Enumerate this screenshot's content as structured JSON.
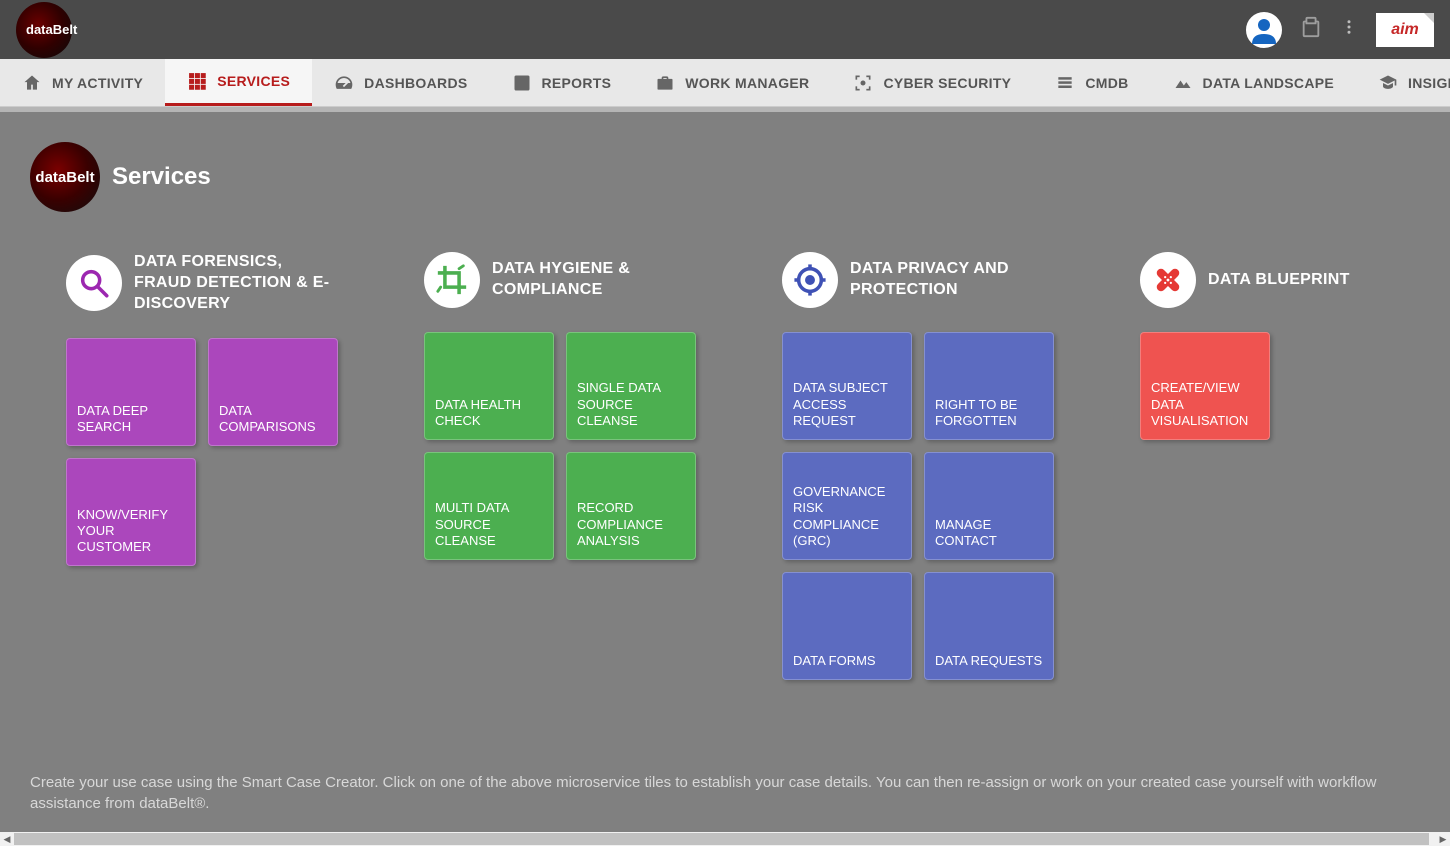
{
  "header": {
    "logo_text": "dataBelt",
    "aim_label": "aim"
  },
  "nav": [
    {
      "label": "MY ACTIVITY",
      "icon": "home"
    },
    {
      "label": "SERVICES",
      "icon": "grid",
      "active": true
    },
    {
      "label": "DASHBOARDS",
      "icon": "speed"
    },
    {
      "label": "REPORTS",
      "icon": "barchart"
    },
    {
      "label": "WORK MANAGER",
      "icon": "briefcase"
    },
    {
      "label": "CYBER SECURITY",
      "icon": "target-square"
    },
    {
      "label": "CMDB",
      "icon": "db"
    },
    {
      "label": "DATA LANDSCAPE",
      "icon": "landscape"
    },
    {
      "label": "INSIGHT SPACE",
      "icon": "grad"
    }
  ],
  "page": {
    "logo_text": "dataBelt",
    "title": "Services"
  },
  "categories": [
    {
      "title": "DATA FORENSICS, FRAUD DETECTION & E-DISCOVERY",
      "icon": "search",
      "icon_color": "#9c27b0",
      "color": "purple",
      "tiles": [
        "DATA DEEP SEARCH",
        "DATA COMPARISONS",
        "KNOW/VERIFY YOUR CUSTOMER"
      ]
    },
    {
      "title": "DATA HYGIENE & COMPLIANCE",
      "icon": "crop",
      "icon_color": "#4caf50",
      "color": "green",
      "tiles": [
        "DATA HEALTH CHECK",
        "SINGLE DATA SOURCE CLEANSE",
        "MULTI DATA SOURCE CLEANSE",
        "RECORD COMPLIANCE ANALYSIS"
      ]
    },
    {
      "title": "DATA PRIVACY AND PROTECTION",
      "icon": "target",
      "icon_color": "#3f51b5",
      "color": "blue",
      "tiles": [
        "DATA SUBJECT ACCESS REQUEST",
        "RIGHT TO BE FORGOTTEN",
        "GOVERNANCE RISK COMPLIANCE (GRC)",
        "MANAGE CONTACT",
        "DATA FORMS",
        "DATA REQUESTS"
      ]
    },
    {
      "title": "DATA BLUEPRINT",
      "icon": "bandage",
      "icon_color": "#e53935",
      "color": "red",
      "tiles": [
        "CREATE/VIEW DATA VISUALISATION"
      ]
    }
  ],
  "footer": "Create your use case using the Smart Case Creator. Click on one of the above microservice tiles to establish your case details. You can then re-assign or work on your created case yourself with workflow assistance from dataBelt®."
}
